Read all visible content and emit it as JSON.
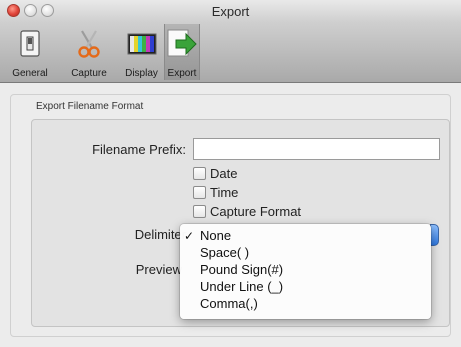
{
  "window": {
    "title": "Export"
  },
  "toolbar": {
    "items": [
      {
        "label": "General",
        "icon": "switch-icon"
      },
      {
        "label": "Capture",
        "icon": "scissors-icon"
      },
      {
        "label": "Display",
        "icon": "display-icon"
      },
      {
        "label": "Export",
        "icon": "export-arrow-icon",
        "selected": true
      }
    ]
  },
  "section": {
    "title": "Export Filename Format"
  },
  "form": {
    "prefix_label": "Filename Prefix:",
    "prefix_value": "",
    "options": [
      {
        "label": "Date",
        "checked": false
      },
      {
        "label": "Time",
        "checked": false
      },
      {
        "label": "Capture Format",
        "checked": false
      }
    ],
    "delimiter_label": "Delimiter",
    "preview_label": "Preview"
  },
  "delimiter_menu": {
    "check_mark": "✓",
    "selected": "None",
    "items": [
      "None",
      "Space( )",
      "Pound Sign(#)",
      "Under Line (_)",
      "Comma(,)"
    ]
  },
  "colors": {
    "accent": "#2f78e0",
    "close_button": "#e0443a"
  }
}
